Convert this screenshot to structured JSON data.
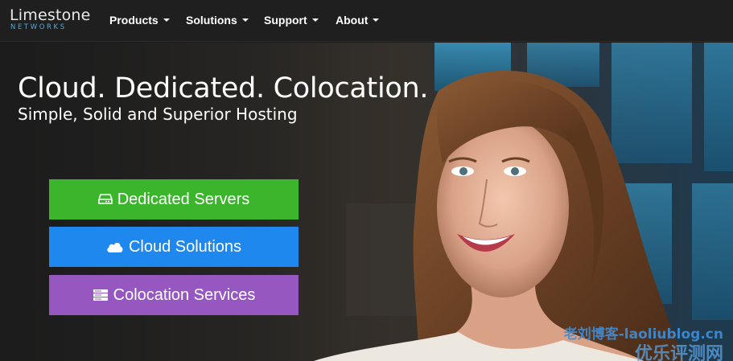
{
  "brand": {
    "name": "Limestone",
    "tagline": "NETWORKS"
  },
  "nav": {
    "items": [
      {
        "label": "Products"
      },
      {
        "label": "Solutions"
      },
      {
        "label": "Support"
      },
      {
        "label": "About"
      }
    ]
  },
  "hero": {
    "title": "Cloud. Dedicated. Colocation.",
    "subtitle": "Simple, Solid and Superior Hosting"
  },
  "cta": [
    {
      "label": "Dedicated Servers",
      "icon": "hdd-icon",
      "color": "#3bb52c"
    },
    {
      "label": "Cloud Solutions",
      "icon": "cloud-icon",
      "color": "#1f88ee"
    },
    {
      "label": "Colocation Services",
      "icon": "server-rack-icon",
      "color": "#9657c0"
    }
  ],
  "watermark": {
    "line1": "老刘博客-laoliublog.cn",
    "line2": "优乐评测网"
  }
}
